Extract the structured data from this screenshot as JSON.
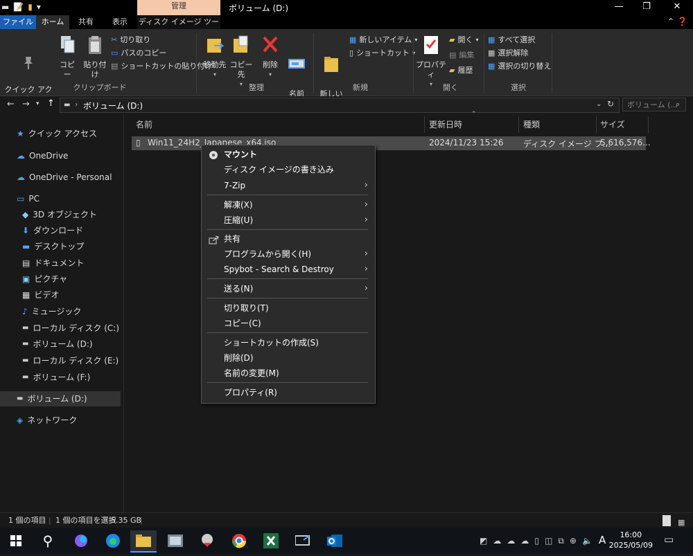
{
  "window": {
    "title": "ボリューム (D:)",
    "context_tab_group": "管理",
    "min_glyph": "—",
    "max_glyph": "❐",
    "close_glyph": "✕"
  },
  "tabs": [
    "ファイル",
    "ホーム",
    "共有",
    "表示",
    "ディスク イメージ ツール"
  ],
  "ribbon": {
    "clipboard": {
      "pin": "クイック アクセ\nスにピン留めする",
      "copy": "コピー",
      "paste": "貼り付け",
      "cut": "切り取り",
      "copy_path": "パスのコピー",
      "paste_shortcut": "ショートカットの貼り付け",
      "group": "クリップボード"
    },
    "organize": {
      "move_to": "移動先",
      "copy_to": "コピー先",
      "delete": "削除",
      "rename": "名前\nの変更",
      "group": "整理"
    },
    "new": {
      "new_folder": "新しい\nフォルダー",
      "new_item": "新しいアイテム",
      "shortcut": "ショートカット",
      "group": "新規"
    },
    "open": {
      "properties": "プロパティ",
      "open": "開く",
      "edit": "編集",
      "history": "履歴",
      "group": "開く"
    },
    "select": {
      "select_all": "すべて選択",
      "select_none": "選択解除",
      "invert": "選択の切り替え",
      "group": "選択"
    }
  },
  "address": {
    "path": "ボリューム (D:)",
    "search_placeholder": "ボリューム (..."
  },
  "nav": [
    {
      "label": "クイック アクセス",
      "icon": "star-icon"
    },
    {
      "label": "OneDrive",
      "icon": "cloud-icon"
    },
    {
      "label": "OneDrive - Personal",
      "icon": "cloud-icon"
    },
    {
      "label": "PC",
      "icon": "pc-icon"
    },
    {
      "label": "3D オブジェクト",
      "icon": "cube-icon"
    },
    {
      "label": "ダウンロード",
      "icon": "download-icon"
    },
    {
      "label": "デスクトップ",
      "icon": "desktop-icon"
    },
    {
      "label": "ドキュメント",
      "icon": "document-icon"
    },
    {
      "label": "ピクチャ",
      "icon": "picture-icon"
    },
    {
      "label": "ビデオ",
      "icon": "video-icon"
    },
    {
      "label": "ミュージック",
      "icon": "music-icon"
    },
    {
      "label": "ローカル ディスク (C:)",
      "icon": "drive-icon"
    },
    {
      "label": "ボリューム (D:)",
      "icon": "drive-icon"
    },
    {
      "label": "ローカル ディスク (E:)",
      "icon": "drive-icon"
    },
    {
      "label": "ボリューム (F:)",
      "icon": "drive-icon"
    },
    {
      "label": "ボリューム (D:)",
      "icon": "drive-icon"
    },
    {
      "label": "ネットワーク",
      "icon": "network-icon"
    }
  ],
  "columns": {
    "name": "名前",
    "date": "更新日時",
    "type": "種類",
    "size": "サイズ"
  },
  "file": {
    "name": "Win11_24H2_Japanese_x64.iso",
    "date": "2024/11/23 15:26",
    "type": "ディスク イメージ フ...",
    "size": "5,616,576..."
  },
  "context_menu": [
    "マウント",
    "ディスク イメージの書き込み",
    "7-Zip",
    "解凍(X)",
    "圧縮(U)",
    "共有",
    "プログラムから開く(H)",
    "Spybot - Search & Destroy",
    "送る(N)",
    "切り取り(T)",
    "コピー(C)",
    "ショートカットの作成(S)",
    "削除(D)",
    "名前の変更(M)",
    "プロパティ(R)"
  ],
  "status": {
    "count": "1 個の項目",
    "selected": "1 個の項目を選択",
    "size": "5.35 GB"
  },
  "taskbar": {
    "ime": "A",
    "time": "16:00",
    "date": "2025/05/09"
  },
  "colors": {
    "accent": "#1a5fb4",
    "context_tab": "#f6c8aa",
    "selection": "#4a4a4a"
  }
}
